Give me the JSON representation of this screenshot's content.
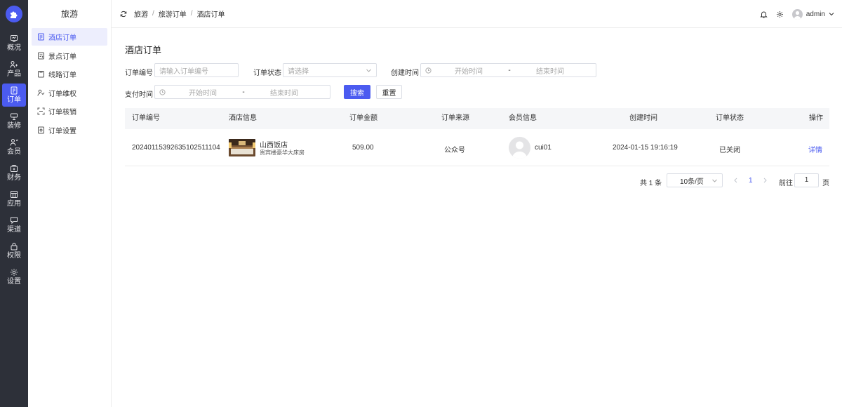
{
  "rail": {
    "items": [
      {
        "label": "概况",
        "icon": "dashboard-icon",
        "active": false
      },
      {
        "label": "产品",
        "icon": "product-icon",
        "active": false
      },
      {
        "label": "订单",
        "icon": "order-icon",
        "active": true
      },
      {
        "label": "装修",
        "icon": "decorate-icon",
        "active": false
      },
      {
        "label": "会员",
        "icon": "member-icon",
        "active": false
      },
      {
        "label": "财务",
        "icon": "finance-icon",
        "active": false
      },
      {
        "label": "应用",
        "icon": "apps-icon",
        "active": false
      },
      {
        "label": "渠道",
        "icon": "channel-icon",
        "active": false
      },
      {
        "label": "权限",
        "icon": "permission-icon",
        "active": false
      },
      {
        "label": "设置",
        "icon": "settings-icon",
        "active": false
      }
    ]
  },
  "submenu": {
    "title": "旅游",
    "items": [
      {
        "label": "酒店订单",
        "active": true
      },
      {
        "label": "景点订单",
        "active": false
      },
      {
        "label": "线路订单",
        "active": false
      },
      {
        "label": "订单维权",
        "active": false
      },
      {
        "label": "订单核销",
        "active": false
      },
      {
        "label": "订单设置",
        "active": false
      }
    ]
  },
  "header": {
    "breadcrumb": [
      "旅游",
      "旅游订单",
      "酒店订单"
    ],
    "separator": "/",
    "username": "admin"
  },
  "page": {
    "title": "酒店订单"
  },
  "filters": {
    "order_no_label": "订单编号",
    "order_no_placeholder": "请输入订单编号",
    "status_label": "订单状态",
    "status_placeholder": "请选择",
    "created_label": "创建时间",
    "paid_label": "支付时间",
    "range_start": "开始时间",
    "range_end": "结束时间",
    "range_dash": "-",
    "search_label": "搜索",
    "reset_label": "重置"
  },
  "table": {
    "columns": [
      "订单编号",
      "酒店信息",
      "订单金额",
      "订单来源",
      "会员信息",
      "创建时间",
      "订单状态",
      "操作"
    ],
    "rows": [
      {
        "order_no": "20240115392635102511104",
        "hotel_name": "山西饭店",
        "room": "贵宾楼豪华大床房",
        "amount": "509.00",
        "source": "公众号",
        "member": "cui01",
        "created": "2024-01-15 19:16:19",
        "status": "已关闭",
        "action": "详情"
      }
    ]
  },
  "pagination": {
    "total": "共 1 条",
    "page_size": "10条/页",
    "current": "1",
    "goto_label": "前往",
    "goto_value": "1",
    "page_suffix": "页"
  },
  "colors": {
    "accent": "#4b5bf0",
    "rail_bg": "#2d3039"
  }
}
